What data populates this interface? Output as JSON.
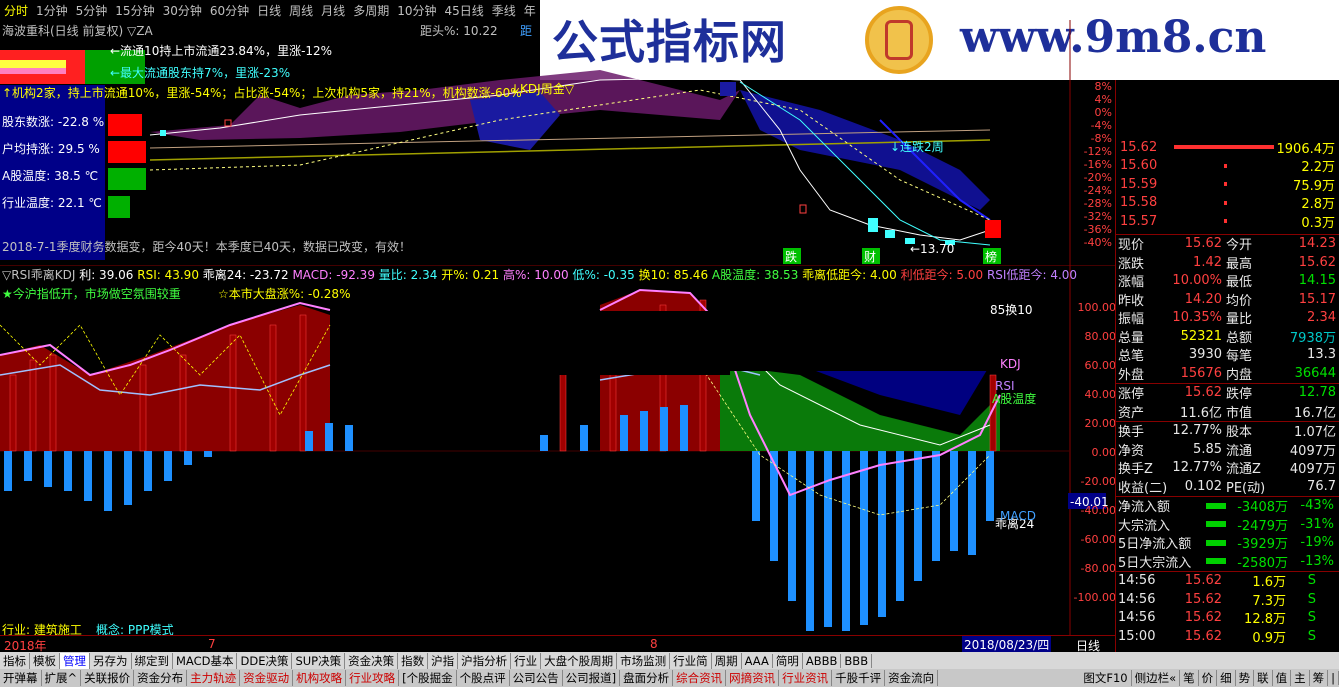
{
  "periods": {
    "items": [
      "分时",
      "1分钟",
      "5分钟",
      "15分钟",
      "30分钟",
      "60分钟",
      "日线",
      "周线",
      "月线",
      "多周期",
      "10分钟",
      "45日线",
      "季线",
      "年"
    ],
    "active": 0
  },
  "banner": {
    "text": "公式指标网",
    "url": "www.9m8.cn",
    "seal": "9m8"
  },
  "main": {
    "title": "海波重科(日线 前复权) ▽ZA",
    "dist": "距头%: 10.22",
    "dist2": "距",
    "flow1": "←流通10持上市流通23.84%，里涨-12%",
    "flow2": "←最大流通股东持7%，里涨-23%",
    "inst": "↑机构2家，持上市流通10%，里涨-54%；占比涨-54%；上次机构5家，持21%，机构数涨-60%",
    "kdj_label": "↓KDJ周金▽",
    "holder": {
      "label": "股东数涨:",
      "value": "-22.8 %"
    },
    "avg": {
      "label": "户均持涨:",
      "value": "29.5 %"
    },
    "market": {
      "label": "A股温度:",
      "value": "38.5 ℃"
    },
    "industry": {
      "label": "行业温度:",
      "value": "22.1 ℃"
    },
    "week": "↓连跌2周",
    "low": "←13.70",
    "report": "2018-7-1季度财务数据变，距今40天！本季度已40天，数据已改变，有效！",
    "mk_die": "跌",
    "mk_cai": "财",
    "mk_bang": "榜",
    "yaxis": [
      "8%",
      "4%",
      "0%",
      "-4%",
      "-8%",
      "-12%",
      "-16%",
      "-20%",
      "-24%",
      "-28%",
      "-32%",
      "-36%",
      "-40%"
    ]
  },
  "sub": {
    "title": "▽RSI乖离KDJ",
    "li": "利: 39.06",
    "rsi": "RSI: 43.90",
    "gl": "乖离24: -23.72",
    "macd": "MACD: -92.39",
    "lb": "量比: 2.34",
    "kai": "开%: 0.21",
    "gao": "高%: 10.00",
    "di": "低%: -0.35",
    "huan": "换10: 85.46",
    "agu": "A股温度: 38.53",
    "gldi": "乖离低距今: 4.00",
    "lidi": "利低距今: 5.00",
    "rsidi": "RSI低距今: 4.00",
    "note1": "★今沪指低开，市场做空氛围较重",
    "note2": "☆本市大盘涨%: -0.28%",
    "r1": "85换10",
    "r2": "KDJ",
    "r3": "RSI",
    "r4": "A股温度",
    "r5": "乖离24",
    "r6": "MACD",
    "cursor": "-40.01",
    "industry": "行业: 建筑施工",
    "concept": "概念: PPP模式",
    "yaxis": [
      "100.00",
      "80.00",
      "60.00",
      "40.00",
      "20.00",
      "0.00",
      "-20.00",
      "-40.00",
      "-60.00",
      "-80.00",
      "-100.00"
    ]
  },
  "timeline": {
    "year": "2018年",
    "m7": "7",
    "m8": "8",
    "date": "2018/08/23/四",
    "period": "日线"
  },
  "orderbook": [
    {
      "price": "15.62",
      "vol": "1906.4万",
      "big": true
    },
    {
      "price": "15.60",
      "vol": "2.2万"
    },
    {
      "price": "15.59",
      "vol": "75.9万"
    },
    {
      "price": "15.58",
      "vol": "2.8万"
    },
    {
      "price": "15.57",
      "vol": "0.3万"
    }
  ],
  "quote": [
    [
      "现价",
      "15.62",
      "今开",
      "14.23"
    ],
    [
      "涨跌",
      "1.42",
      "最高",
      "15.62"
    ],
    [
      "涨幅",
      "10.00%",
      "最低",
      "14.15"
    ],
    [
      "昨收",
      "14.20",
      "均价",
      "15.17"
    ],
    [
      "振幅",
      "10.35%",
      "量比",
      "2.34"
    ],
    [
      "总量",
      "52321",
      "总额",
      "7938万"
    ],
    [
      "总笔",
      "3930",
      "每笔",
      "13.3"
    ],
    [
      "外盘",
      "15676",
      "内盘",
      "36644"
    ]
  ],
  "quote2": [
    [
      "涨停",
      "15.62",
      "跌停",
      "12.78"
    ],
    [
      "资产",
      "11.6亿",
      "市值",
      "16.7亿"
    ]
  ],
  "quote3": [
    [
      "换手",
      "12.77%",
      "股本",
      "1.07亿"
    ],
    [
      "净资",
      "5.85",
      "流通",
      "4097万"
    ],
    [
      "换手Z",
      "12.77%",
      "流通Z",
      "4097万"
    ],
    [
      "收益(二)",
      "0.102",
      "PE(动)",
      "76.7"
    ]
  ],
  "flows": [
    [
      "净流入额",
      "-3408万",
      "-43%"
    ],
    [
      "大宗流入",
      "-2479万",
      "-31%"
    ],
    [
      "5日净流入额",
      "-3929万",
      "-19%"
    ],
    [
      "5日大宗流入",
      "-2580万",
      "-13%"
    ]
  ],
  "ticks": [
    [
      "14:56",
      "15.62",
      "1.6万",
      "S"
    ],
    [
      "14:56",
      "15.62",
      "7.3万",
      "S"
    ],
    [
      "14:56",
      "15.62",
      "12.8万",
      "S"
    ],
    [
      "15:00",
      "15.62",
      "0.9万",
      "S"
    ]
  ],
  "tabs1": [
    "指标",
    "模板",
    "管理",
    "另存为",
    "绑定到",
    "MACD基本",
    "DDE决策",
    "SUP决策",
    "资金决策",
    "指数",
    "沪指",
    "沪指分析",
    "行业",
    "大盘个股周期",
    "市场监测",
    "行业简",
    "周期",
    "AAA",
    "简明",
    "ABBB",
    "BBB"
  ],
  "tabs1_active": 2,
  "tabs2": [
    "开弹幕",
    "扩展^",
    "关联报价",
    "资金分布",
    "主力轨迹",
    "资金驱动",
    "机构攻略",
    "行业攻略",
    "[个股掘金",
    "个股点评",
    "公司公告",
    "公司报道]",
    "盘面分析",
    "综合资讯",
    "网摘资讯",
    "行业资讯",
    "千股千评",
    "资金流向"
  ],
  "tabs2_right": [
    "图文F10",
    "侧边栏«",
    "笔",
    "价",
    "细",
    "势",
    "联",
    "值",
    "主",
    "筹",
    "|"
  ],
  "colors": {
    "up": "#ff4040",
    "down": "#00e000",
    "flat": "#e8e8e8",
    "accent": "#ffff00"
  }
}
